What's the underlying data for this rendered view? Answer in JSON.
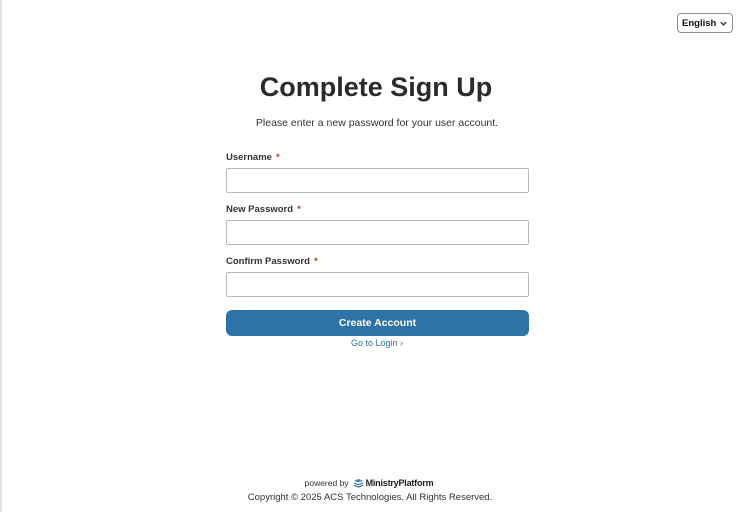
{
  "language_select": {
    "selected": "English"
  },
  "page": {
    "title": "Complete Sign Up",
    "subtitle": "Please enter a new password for your user account."
  },
  "form": {
    "username_label": "Username",
    "new_password_label": "New Password",
    "confirm_password_label": "Confirm Password",
    "required_marker": "*",
    "username_value": "",
    "new_password_value": "",
    "confirm_password_value": "",
    "submit_label": "Create Account",
    "login_link": "Go to Login ›"
  },
  "footer": {
    "powered_by": "powered by",
    "brand": "MinistryPlatform",
    "copyright": "Copyright © 2025 ACS Technologies. All Rights Reserved."
  },
  "colors": {
    "primary_button": "#2e73a8",
    "link": "#2e73a8",
    "required": "#c0392b"
  },
  "icons": {
    "language_dropdown": "chevron-down-icon",
    "brand_logo": "ministryplatform-logo-icon"
  }
}
